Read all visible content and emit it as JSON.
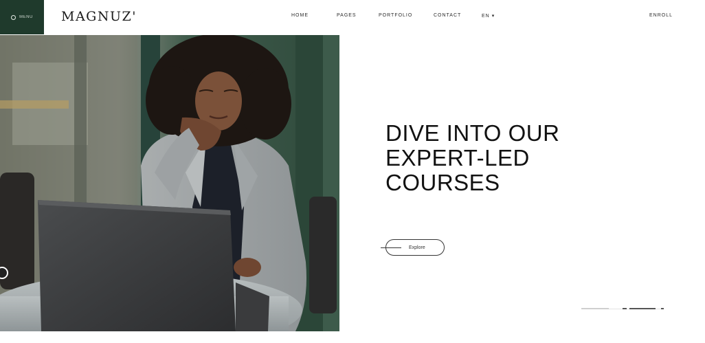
{
  "header": {
    "menu_label": "MENU",
    "logo": "MAGNUZ'",
    "nav": [
      "Home",
      "Pages",
      "Portfolio",
      "Contact",
      "EN"
    ],
    "cta": "Enroll"
  },
  "hero": {
    "eyebrow": "",
    "title_lines": [
      "DIVE INTO OUR",
      "EXPERT-LED",
      "COURSES"
    ],
    "subtitle_lines": [
      "",
      ""
    ],
    "button_label": "Explore"
  },
  "colors": {
    "brand_dark_green": "#1f3a2c",
    "text_dark": "#111111"
  },
  "icons": {
    "menu": "menu-dot-icon",
    "nav_dropdown": "chevron-down-icon",
    "button": "arrow-line-icon"
  }
}
